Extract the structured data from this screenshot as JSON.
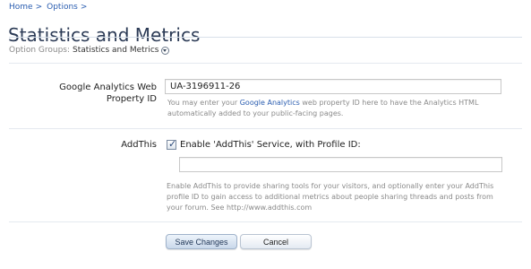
{
  "breadcrumb": {
    "items": [
      "Home",
      "Options"
    ],
    "separator": ">"
  },
  "page_title": "Statistics and Metrics",
  "option_groups": {
    "label": "Option Groups:",
    "value": "Statistics and Metrics",
    "icon": "chevron-down-icon"
  },
  "google_analytics": {
    "label": "Google Analytics Web Property ID",
    "value": "UA-3196911-26",
    "hint_before": "You may enter your ",
    "hint_link": "Google Analytics",
    "hint_after": " web property ID here to have the Analytics HTML automatically added to your public-facing pages."
  },
  "addthis": {
    "label": "AddThis",
    "checkbox_label": "Enable 'AddThis' Service, with Profile ID:",
    "checked": true,
    "value": "",
    "hint": "Enable AddThis to provide sharing tools for your visitors, and optionally enter your AddThis profile ID to gain access to additional metrics about people sharing threads and posts from your forum. See http://www.addthis.com"
  },
  "buttons": {
    "save": "Save Changes",
    "cancel": "Cancel"
  },
  "colors": {
    "link": "#2a5db0",
    "title": "#2b3a55",
    "hint": "#8a8a8a"
  }
}
